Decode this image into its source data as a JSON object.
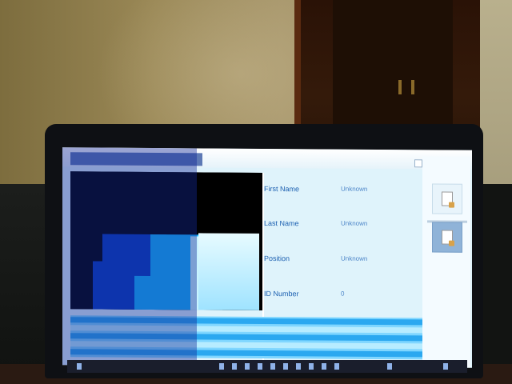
{
  "app": {
    "fields": [
      {
        "label": "First Name",
        "value": "Unknown"
      },
      {
        "label": "Last Name",
        "value": "Unknown"
      },
      {
        "label": "Position",
        "value": "Unknown"
      },
      {
        "label": "ID Number",
        "value": "0"
      }
    ]
  },
  "colors": {
    "screen_background": "#dff3fb",
    "accent_blue": "#1b5fb0",
    "grid_blue": "#2ba8f0"
  },
  "icons": {
    "side_button_1": "document-icon",
    "side_button_2": "document-icon"
  }
}
